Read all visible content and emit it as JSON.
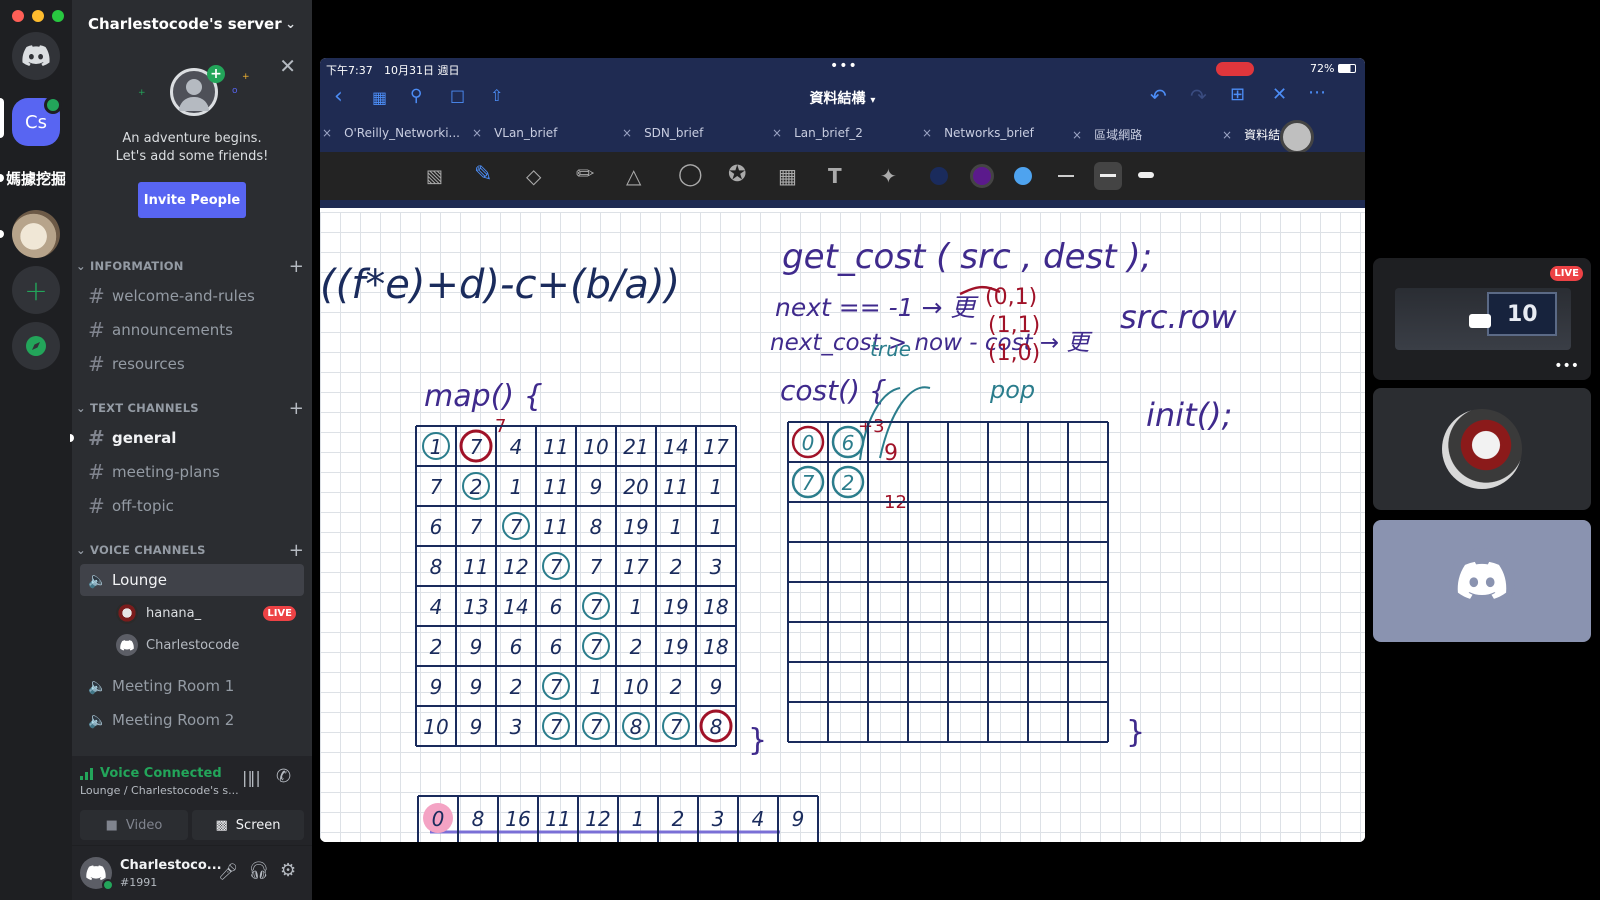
{
  "server": {
    "name": "Charlestocode's server",
    "rail_icons": [
      {
        "name": "discord-home",
        "label": ""
      },
      {
        "name": "server-cs",
        "label": "Cs"
      },
      {
        "name": "server-mining",
        "label": "媽據挖掘"
      },
      {
        "name": "server-avatar",
        "label": ""
      },
      {
        "name": "add-server",
        "label": "+"
      },
      {
        "name": "explore",
        "label": ""
      }
    ]
  },
  "invite": {
    "line1": "An adventure begins.",
    "line2": "Let's add some friends!",
    "button": "Invite People"
  },
  "categories": {
    "information": "INFORMATION",
    "text": "TEXT CHANNELS",
    "voice": "VOICE CHANNELS"
  },
  "channels": {
    "information": [
      "welcome-and-rules",
      "announcements",
      "resources"
    ],
    "text": [
      "general",
      "meeting-plans",
      "off-topic"
    ],
    "voice": [
      "Lounge",
      "Meeting Room 1",
      "Meeting Room 2"
    ]
  },
  "voice_users": [
    {
      "name": "hanana_",
      "badge": "LIVE"
    },
    {
      "name": "Charlestocode",
      "badge": ""
    }
  ],
  "voice_status": {
    "title": "Voice Connected",
    "subtitle": "Lounge / Charlestocode's s...",
    "video_label": "Video",
    "screen_label": "Screen"
  },
  "user": {
    "name": "Charlestoco...",
    "tag": "#1991"
  },
  "ipad": {
    "status_time": "下午7:37",
    "status_date": "10月31日 週日",
    "battery": "72%",
    "doc_title": "資料結構",
    "tabs": [
      "O'Reilly_Networki...",
      "VLan_brief",
      "SDN_brief",
      "Lan_brief_2",
      "Networks_brief",
      "區域網路",
      "資料結構"
    ]
  },
  "notes": {
    "formula": "((f*e)+d)-c+(b/a))",
    "get_cost": "get_cost ( src , dest );",
    "next_line": "next == -1 → 更",
    "next_cost": "next_cost > now - cost → 更",
    "coords": [
      "(0,1)",
      "(1,1)",
      "(1,0)"
    ],
    "true": "true",
    "pop": "pop",
    "src_row": "src.row",
    "map": "map() {",
    "cost": "cost() {",
    "init": "init();",
    "brace": "}",
    "above_7": "7",
    "plus3": "+3",
    "twelve": "12",
    "nine": "9",
    "left_grid": [
      [
        "1",
        "7",
        "4",
        "11",
        "10",
        "21",
        "14",
        "17"
      ],
      [
        "7",
        "2",
        "1",
        "11",
        "9",
        "20",
        "11",
        "1"
      ],
      [
        "6",
        "7",
        "7",
        "11",
        "8",
        "19",
        "1",
        "1"
      ],
      [
        "8",
        "11",
        "12",
        "7",
        "7",
        "17",
        "2",
        "3"
      ],
      [
        "4",
        "13",
        "14",
        "6",
        "7",
        "1",
        "19",
        "18"
      ],
      [
        "2",
        "9",
        "6",
        "6",
        "7",
        "2",
        "19",
        "18"
      ],
      [
        "9",
        "9",
        "2",
        "7",
        "1",
        "10",
        "2",
        "9"
      ],
      [
        "10",
        "9",
        "3",
        "7",
        "7",
        "8",
        "7",
        "8"
      ]
    ],
    "right_grid_cells": [
      "0",
      "6",
      "7",
      "2"
    ],
    "bottom_row": [
      "0",
      "8",
      "16",
      "11",
      "12",
      "1",
      "2",
      "3",
      "4",
      "9"
    ]
  },
  "tiles": {
    "live_label": "LIVE",
    "screen_number": "10"
  },
  "colors": {
    "blurple": "#5865f2",
    "live_red": "#ed4245",
    "voice_green": "#23a55a",
    "ipad_nav": "#1f2b52"
  }
}
